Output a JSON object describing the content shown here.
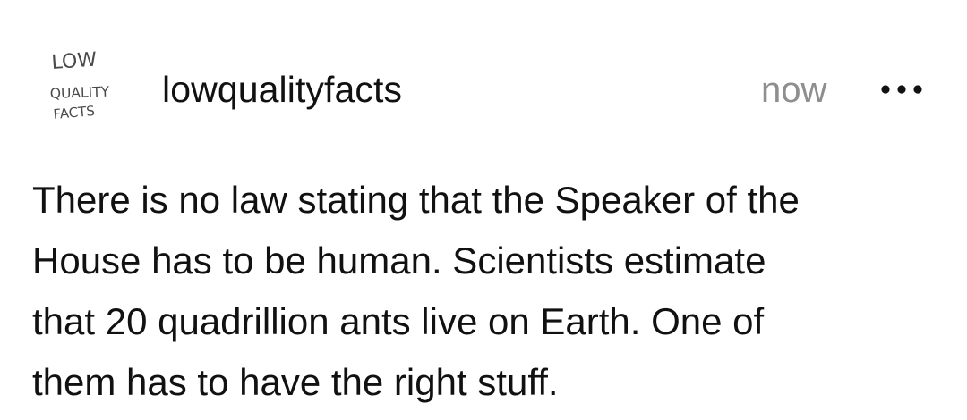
{
  "post": {
    "avatar": {
      "lines": [
        "LOW",
        "QUALITY",
        "FACTS"
      ],
      "icon": "handwritten-logo"
    },
    "username": "lowqualityfacts",
    "timestamp": "now",
    "more_icon": "ellipsis-horizontal-icon",
    "body_lines": [
      "There is no law stating that the Speaker of the",
      "House has to be human. Scientists estimate",
      "that 20 quadrillion ants live on Earth. One of",
      "them has to have the right stuff."
    ]
  },
  "colors": {
    "background": "#ffffff",
    "text": "#111111",
    "muted": "#8e8e8e"
  }
}
